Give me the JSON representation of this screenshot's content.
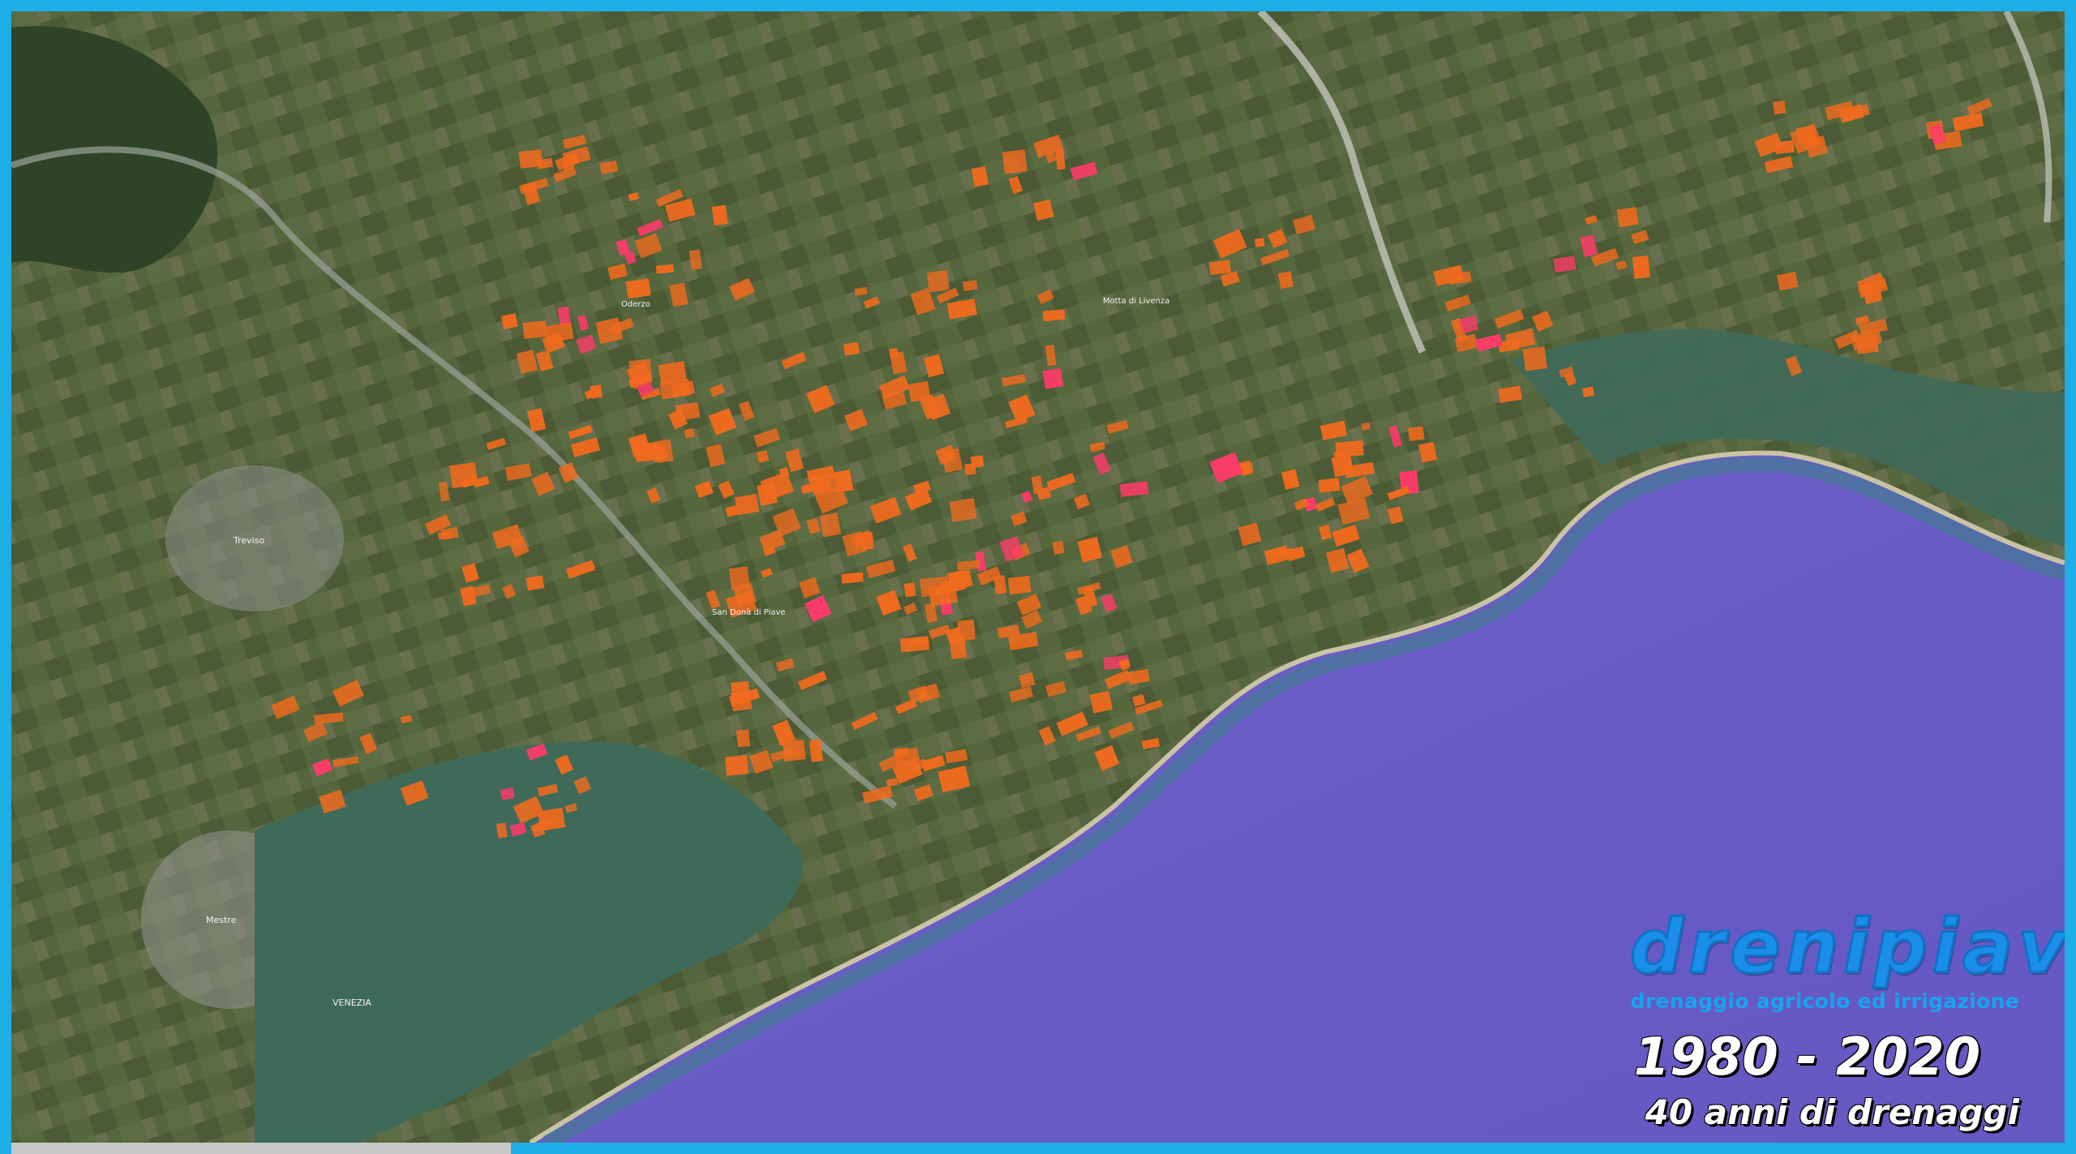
{
  "map": {
    "place_labels": [
      "Mestre",
      "VENEZIA",
      "Treviso",
      "Oderzo",
      "San Donà di Piave",
      "Motta di Livenza"
    ],
    "colors": {
      "land": "#55643c",
      "sea": "#6b5cc6",
      "lagoon": "#3f6a5a",
      "drainage_area": "#f06a1e",
      "drainage_area_highlight": "#ff3a6a",
      "coast": "#c9c3a5",
      "frame": "#1eaee6"
    }
  },
  "brand": {
    "logo": "drenipiave",
    "tagline": "drenaggio agricolo ed irrigazione",
    "years": "1980 - 2020",
    "subtitle": "40 anni di drenaggi"
  }
}
